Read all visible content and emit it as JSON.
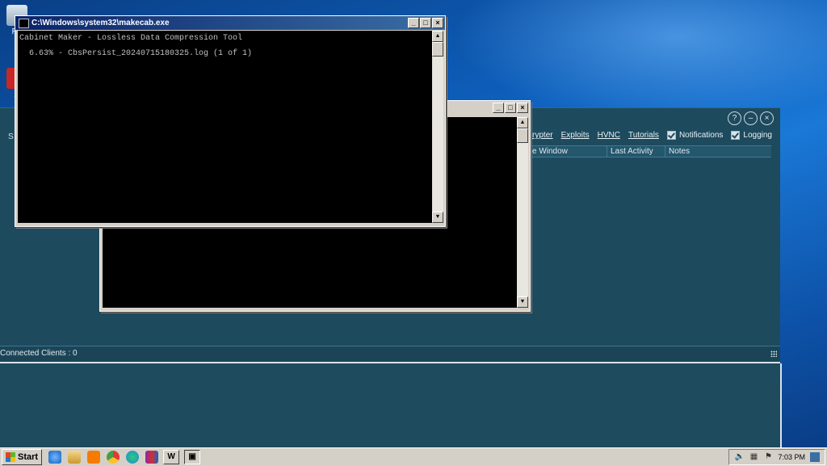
{
  "desktop": {
    "icons": [
      {
        "name": "recycle-bin-icon",
        "label": "Re"
      },
      {
        "name": "app-shortcut-icon",
        "label": "A"
      }
    ]
  },
  "console_front": {
    "title": "C:\\Windows\\system32\\makecab.exe",
    "lines": [
      "Cabinet Maker - Lossless Data Compression Tool",
      "  6.63% - CbsPersist_20240715180325.log (1 of 1)"
    ]
  },
  "console_back": {
    "title": ""
  },
  "rat_panel": {
    "left_label": "S",
    "links": [
      "Crypter",
      "Exploits",
      "HVNC",
      "Tutorials"
    ],
    "toggles": [
      {
        "label": "Notifications",
        "checked": true
      },
      {
        "label": "Logging",
        "checked": true
      }
    ],
    "columns": [
      "e Window",
      "Last Activity",
      "Notes"
    ],
    "status": "Connected Clients : 0",
    "controls": [
      "?",
      "–",
      "×"
    ]
  },
  "taskbar": {
    "start_label": "Start",
    "task_word_label": "W",
    "clock": "7:03 PM"
  },
  "colors": {
    "titlebar_active": "#0a246a",
    "panel_bg": "#1e4a5e",
    "console_bg": "#000000"
  }
}
